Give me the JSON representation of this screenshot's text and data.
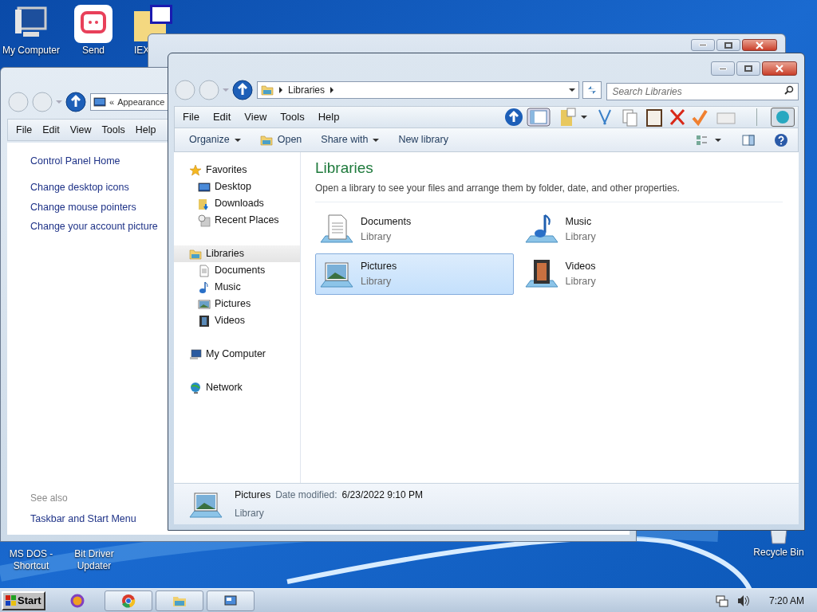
{
  "desktop_icons_top": [
    {
      "label": "My Computer",
      "kind": "computer"
    },
    {
      "label": "Send",
      "kind": "send"
    },
    {
      "label": "IEX",
      "kind": "folder"
    }
  ],
  "desktop_icons_bottom": [
    {
      "label": "MS DOS - Shortcut"
    },
    {
      "label": "Bit Driver Updater"
    }
  ],
  "recycle_bin": {
    "label": "Recycle Bin"
  },
  "control_panel": {
    "address_prefix": "«",
    "address": "Appearance",
    "menu": [
      "File",
      "Edit",
      "View",
      "Tools",
      "Help"
    ],
    "links": [
      {
        "label": "Control Panel Home",
        "kind": "home"
      },
      {
        "label": "Change desktop icons",
        "kind": "task"
      },
      {
        "label": "Change mouse pointers",
        "kind": "task"
      },
      {
        "label": "Change your account picture",
        "kind": "task"
      }
    ],
    "see_also_heading": "See also",
    "see_also": [
      "Taskbar and Start Menu"
    ]
  },
  "explorer": {
    "breadcrumb": "Libraries",
    "search_placeholder": "Search Libraries",
    "menu": [
      "File",
      "Edit",
      "View",
      "Tools",
      "Help"
    ],
    "commands": [
      {
        "label": "Organize",
        "dropdown": true,
        "kind": "plain"
      },
      {
        "label": "Open",
        "dropdown": false,
        "kind": "folder"
      },
      {
        "label": "Share with",
        "dropdown": true,
        "kind": "plain"
      },
      {
        "label": "New library",
        "dropdown": false,
        "kind": "plain"
      }
    ],
    "nav": [
      {
        "label": "Favorites",
        "kind": "star",
        "selected": false,
        "children": [
          {
            "label": "Desktop",
            "kind": "desktop",
            "selected": false
          },
          {
            "label": "Downloads",
            "kind": "downloads",
            "selected": false
          },
          {
            "label": "Recent Places",
            "kind": "recent",
            "selected": false
          }
        ]
      },
      {
        "label": "Libraries",
        "kind": "library",
        "selected": true,
        "children": [
          {
            "label": "Documents",
            "kind": "documents",
            "selected": false
          },
          {
            "label": "Music",
            "kind": "music",
            "selected": false
          },
          {
            "label": "Pictures",
            "kind": "pictures",
            "selected": false
          },
          {
            "label": "Videos",
            "kind": "videos",
            "selected": false
          }
        ]
      },
      {
        "label": "My Computer",
        "kind": "computer",
        "selected": false
      },
      {
        "label": "Network",
        "kind": "network",
        "selected": false
      }
    ],
    "title": "Libraries",
    "description": "Open a library to see your files and arrange them by folder, date, and other properties.",
    "items": [
      {
        "name": "Documents",
        "type": "Library",
        "kind": "documents",
        "selected": false
      },
      {
        "name": "Music",
        "type": "Library",
        "kind": "music",
        "selected": false
      },
      {
        "name": "Pictures",
        "type": "Library",
        "kind": "pictures",
        "selected": true
      },
      {
        "name": "Videos",
        "type": "Library",
        "kind": "videos",
        "selected": false
      }
    ],
    "details": {
      "name": "Pictures",
      "date_label": "Date modified:",
      "date": "6/23/2022 9:10 PM",
      "type": "Library"
    }
  },
  "taskbar": {
    "start": "Start",
    "buttons": [
      {
        "kind": "browser-alt",
        "active": false
      },
      {
        "kind": "chrome",
        "active": true
      },
      {
        "kind": "explorer",
        "active": true
      },
      {
        "kind": "control",
        "active": true
      }
    ],
    "time": "7:20 AM"
  }
}
